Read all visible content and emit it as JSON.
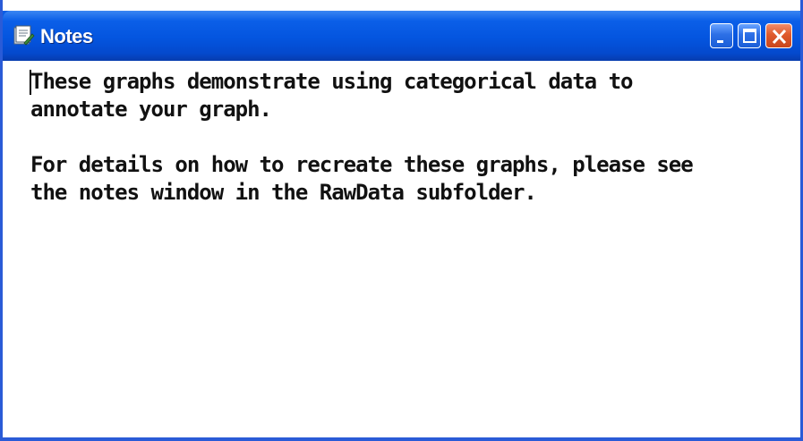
{
  "window": {
    "title": "Notes",
    "controls": {
      "minimize_icon": "minimize-icon",
      "maximize_icon": "maximize-icon",
      "close_icon": "close-icon"
    },
    "colors": {
      "titlebar": "#0453dc",
      "close_button": "#df5a2c"
    }
  },
  "document": {
    "lines": [
      "These graphs demonstrate using categorical data to",
      "annotate your graph.",
      "",
      "For details on how to recreate these graphs, please see",
      "the notes window in the RawData subfolder."
    ]
  }
}
